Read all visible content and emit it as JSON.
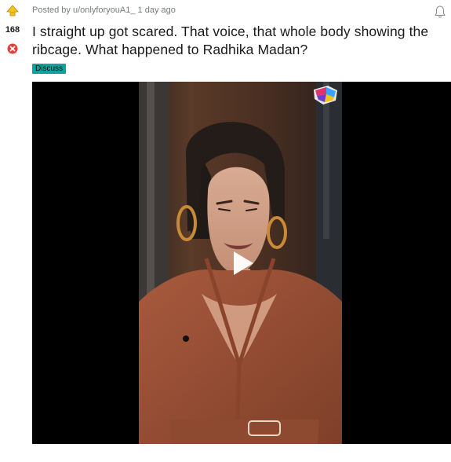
{
  "post": {
    "author_line": "Posted by u/onlyforyouA1_",
    "time": "1 day ago",
    "score": "168",
    "title": "I straight up got scared. That voice, that whole body showing the ribcage. What happened to Radhika Madan?",
    "flair": "Discuss"
  },
  "icons": {
    "upvote": "upvote-arrow-icon",
    "downvote": "downvote-x-icon",
    "bell": "bell-icon",
    "play": "play-icon",
    "channel_logo": "channel-logo-icon"
  },
  "colors": {
    "upvote_fill": "#f5c518",
    "downvote_fill": "#e0413a",
    "flair_bg": "#14a19b",
    "video_bg": "#000000"
  }
}
